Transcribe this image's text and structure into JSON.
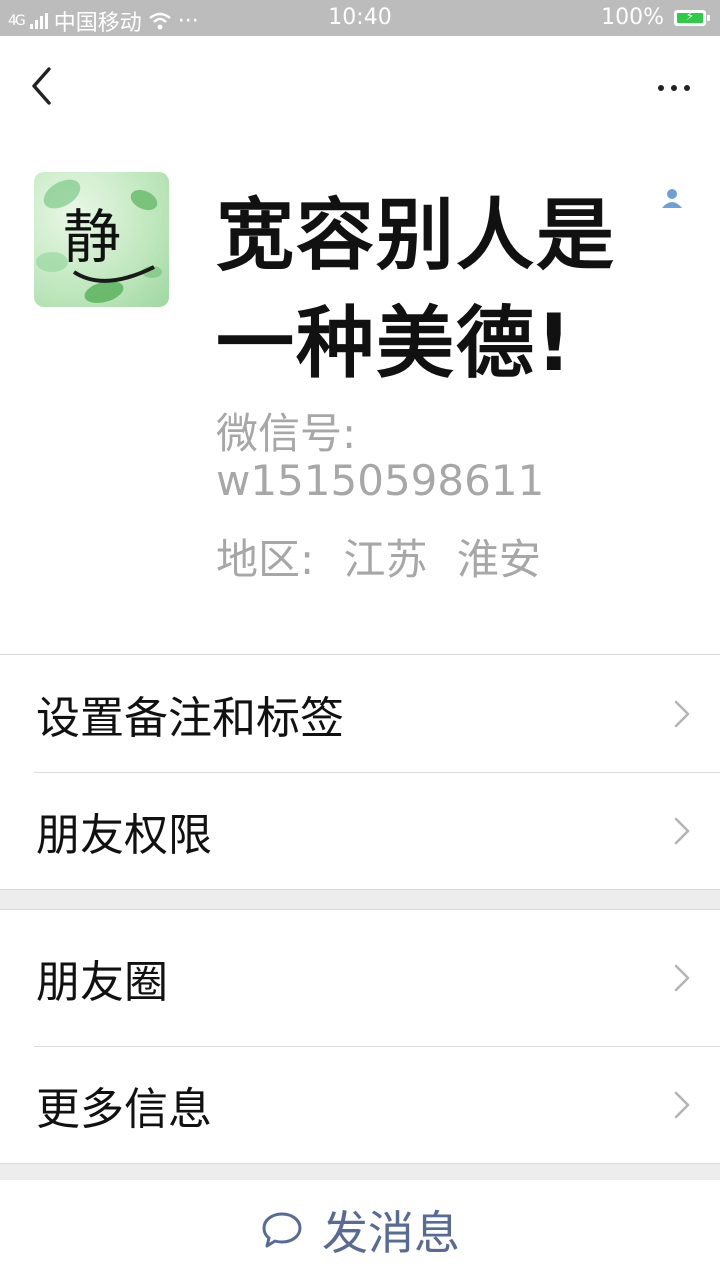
{
  "status_bar": {
    "signal_tag": "4G",
    "carrier": "中国移动",
    "more": "···",
    "time": "10:40",
    "battery_percent": "100%",
    "battery_color": "#2dcb47"
  },
  "nav": {
    "back_icon": "chevron-left-icon",
    "more_icon": "more-dots-icon"
  },
  "profile": {
    "name": "宽容别人是一种美德!",
    "wechat_id_label": "微信号:",
    "wechat_id": "w15150598611",
    "region_label": "地区:",
    "region_province": "江苏",
    "region_city": "淮安",
    "avatar_text": "静",
    "contact_icon": "contact-person-icon"
  },
  "menu_group_1": {
    "items": [
      {
        "label": "设置备注和标签"
      },
      {
        "label": "朋友权限"
      }
    ]
  },
  "menu_group_2": {
    "items": [
      {
        "label": "朋友圈"
      },
      {
        "label": "更多信息"
      }
    ]
  },
  "send_message": {
    "label": "发消息",
    "icon": "chat-bubble-icon",
    "color": "#576b95"
  }
}
